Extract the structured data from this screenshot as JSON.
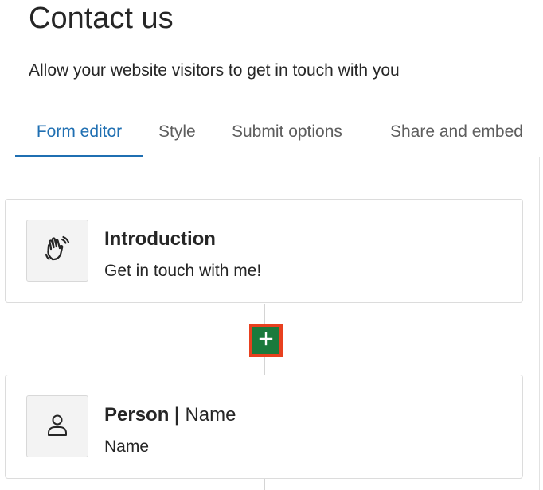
{
  "header": {
    "title": "Contact us",
    "subtitle": "Allow your website visitors to get in touch with you"
  },
  "tabs": [
    {
      "label": "Form editor",
      "active": true
    },
    {
      "label": "Style",
      "active": false
    },
    {
      "label": "Submit options",
      "active": false
    },
    {
      "label": "Share and embed",
      "active": false
    }
  ],
  "blocks": [
    {
      "icon": "waving-hand-icon",
      "title": "Introduction",
      "description": "Get in touch with me!"
    },
    {
      "icon": "person-icon",
      "title": "Person",
      "separator": "|",
      "title_suffix": "Name",
      "description": "Name"
    }
  ],
  "add_block": {
    "icon": "plus-icon",
    "label": "+"
  },
  "colors": {
    "accent": "#1f6fb2",
    "add_button": "#1b7a3c",
    "highlight": "#e8401f"
  }
}
